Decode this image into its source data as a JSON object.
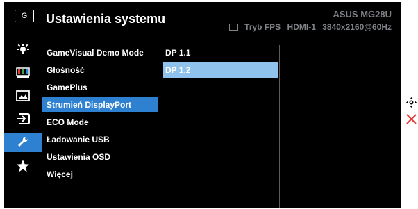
{
  "header": {
    "logo_text": "G",
    "title": "Ustawienia systemu",
    "brand": "ASUS  MG28U",
    "status": {
      "mode": "Tryb FPS",
      "input": "HDMI-1",
      "resolution": "3840x2160@60Hz"
    }
  },
  "sidebar": {
    "icons": [
      "splendid-icon",
      "color-icon",
      "image-icon",
      "input-select-icon",
      "system-setup-icon",
      "shortcut-star-icon"
    ],
    "active_index": 4
  },
  "menu": {
    "items": [
      "GameVisual Demo Mode",
      "Głośność",
      "GamePlus",
      "Strumień DisplayPort",
      "ECO Mode",
      "Ładowanie USB",
      "Ustawienia OSD",
      "Więcej"
    ],
    "active_index": 3
  },
  "submenu": {
    "items": [
      "DP 1.1",
      "DP 1.2"
    ],
    "active_index": 1
  },
  "colors": {
    "background": "#000000",
    "active_blue": "#2e80d0",
    "submenu_highlight": "#8fc3ee",
    "header_text_gray": "#7f8287",
    "close_red": "#e53935"
  },
  "side_controls": [
    "move-icon",
    "close-icon"
  ]
}
